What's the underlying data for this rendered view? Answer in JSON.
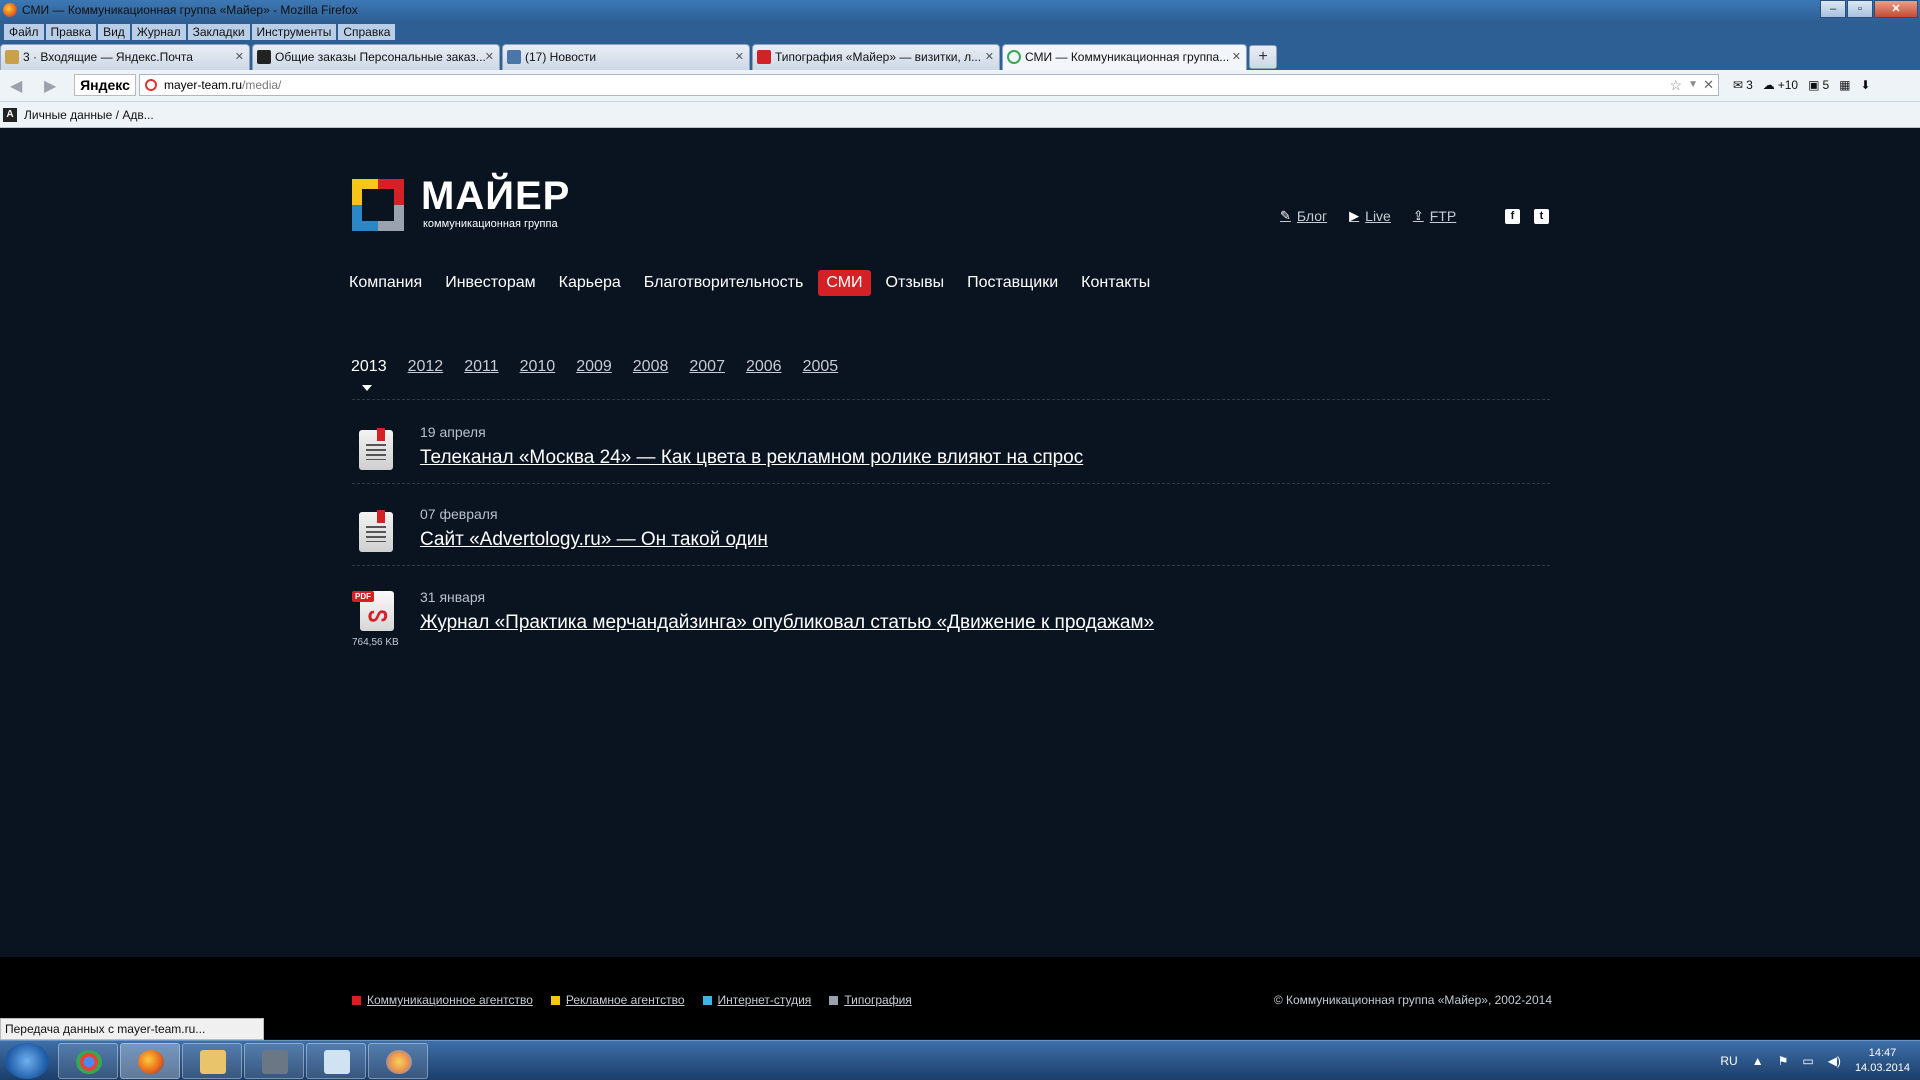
{
  "window": {
    "title": "СМИ — Коммуникационная группа «Майер» - Mozilla Firefox"
  },
  "menu": [
    "Файл",
    "Правка",
    "Вид",
    "Журнал",
    "Закладки",
    "Инструменты",
    "Справка"
  ],
  "tabs": [
    {
      "label": "3 · Входящие — Яндекс.Почта",
      "icon_color": "#c9a14a"
    },
    {
      "label": "Общие заказы Персональные заказ...",
      "icon_color": "#222222"
    },
    {
      "label": "(17) Новости",
      "icon_color": "#4a76a8"
    },
    {
      "label": "Типография «Майер» — визитки, л...",
      "icon_color": "#d42126"
    },
    {
      "label": "СМИ — Коммуникационная группа...",
      "icon_color": "#3aa757"
    }
  ],
  "navbar": {
    "yandex_label": "Яндекс",
    "url_host": "mayer-team.ru",
    "url_path": "/media/",
    "mail_count": "3",
    "weather": "+10",
    "notifications": "5"
  },
  "bookmarks": {
    "item": "Личные данные / Адв..."
  },
  "site": {
    "brand": "МАЙЕР",
    "tagline": "коммуникационная группа",
    "logo_colors": {
      "red": "#d42126",
      "yellow": "#f5c51a",
      "blue": "#2a87c8",
      "gray": "#9aa3ad"
    },
    "top_links": [
      {
        "icon": "pencil-icon",
        "label": "Блог"
      },
      {
        "icon": "play-icon",
        "label": "Live"
      },
      {
        "icon": "upload-icon",
        "label": "FTP"
      }
    ],
    "nav": [
      "Компания",
      "Инвесторам",
      "Карьера",
      "Благотворительность",
      "СМИ",
      "Отзывы",
      "Поставщики",
      "Контакты"
    ],
    "active_nav": "СМИ",
    "years": [
      "2013",
      "2012",
      "2011",
      "2010",
      "2009",
      "2008",
      "2007",
      "2006",
      "2005"
    ],
    "current_year": "2013",
    "items": [
      {
        "date": "19 апреля",
        "title": "Телеканал «Москва 24» — Как цвета в рекламном ролике влияют на спрос",
        "icon": "document-icon"
      },
      {
        "date": "07 февраля",
        "title": "Сайт «Advertology.ru» — Он такой один",
        "icon": "document-icon"
      },
      {
        "date": "31 января",
        "title": "Журнал «Практика мерчандайзинга» опубликовал статью «Движение к продажам»",
        "icon": "pdf-icon",
        "pdf_badge": "PDF",
        "size": "764,56 KB"
      }
    ],
    "footer": {
      "links": [
        {
          "label": "Коммуникационное агентство",
          "color": "#d42126"
        },
        {
          "label": "Рекламное агентство",
          "color": "#f5c51a"
        },
        {
          "label": "Интернет-студия",
          "color": "#3bb4e6"
        },
        {
          "label": "Типография",
          "color": "#9aa3ad"
        }
      ],
      "copyright": "© Коммуникационная группа «Майер», 2002-2014"
    }
  },
  "status": "Передача данных с mayer-team.ru...",
  "taskbar": {
    "lang": "RU",
    "time": "14:47",
    "date": "14.03.2014"
  }
}
